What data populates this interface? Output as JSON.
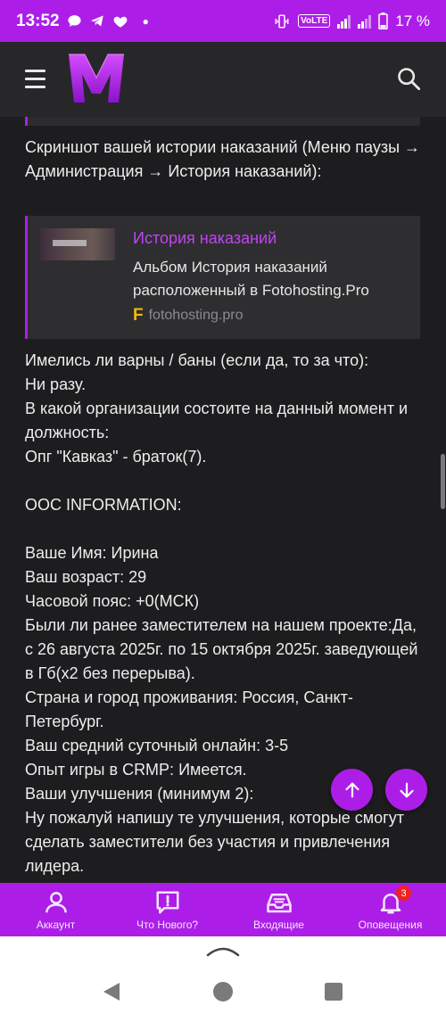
{
  "status_bar": {
    "time": "13:52",
    "left_icons": [
      "chat-bubble-icon",
      "telegram-icon",
      "heart-icon",
      "dot-icon"
    ],
    "volte": "VoLTE",
    "battery": "17 %"
  },
  "header": {
    "menu_icon": "hamburger-icon",
    "logo": "M",
    "search_icon": "search-icon"
  },
  "post": {
    "paragraph1": "Скриншот вашей истории наказаний (Меню паузы → Администрация → История наказаний):",
    "link_card": {
      "title": "История наказаний",
      "description": "Альбом История наказаний расположенный в Fotohosting.Pro",
      "site_icon": "F",
      "site": "fotohosting.pro"
    },
    "lines": [
      "Имелись ли варны / баны (если да, то за что):",
      "Ни разу.",
      "В какой организации состоите на данный момент и должность:",
      "Опг \"Кавказ\" - браток(7).",
      "",
      "OOC INFORMATION:",
      "",
      "Ваше Имя: Ирина",
      "Ваш возраст: 29",
      "Часовой пояс: +0(МСК)",
      "Были ли ранее заместителем на нашем проекте:Да, с 26 августа 2025г. по 15 октября 2025г. заведующей в Гб(x2 без перерыва).",
      "Страна и город проживания: Россия, Санкт-Петербург.",
      "Ваш средний суточный онлайн: 3-5",
      "Опыт игры в CRMP: Имеется.",
      "Ваши улучшения (минимум 2):",
      "Ну пожалуй напишу те улучшения, которые смогут сделать заместители без участия и привлечения лидера."
    ]
  },
  "fabs": {
    "up_icon": "arrow-up-icon",
    "down_icon": "arrow-down-icon"
  },
  "bottom_nav": [
    {
      "label": "Аккаунт",
      "icon": "user-icon"
    },
    {
      "label": "Что Нового?",
      "icon": "new-message-icon"
    },
    {
      "label": "Входящие",
      "icon": "inbox-icon"
    },
    {
      "label": "Оповещения",
      "icon": "bell-icon",
      "badge": "3"
    }
  ],
  "colors": {
    "accent": "#ac1ee8",
    "background": "#1d1d1f",
    "header": "#27272a",
    "link": "#c144f0"
  }
}
